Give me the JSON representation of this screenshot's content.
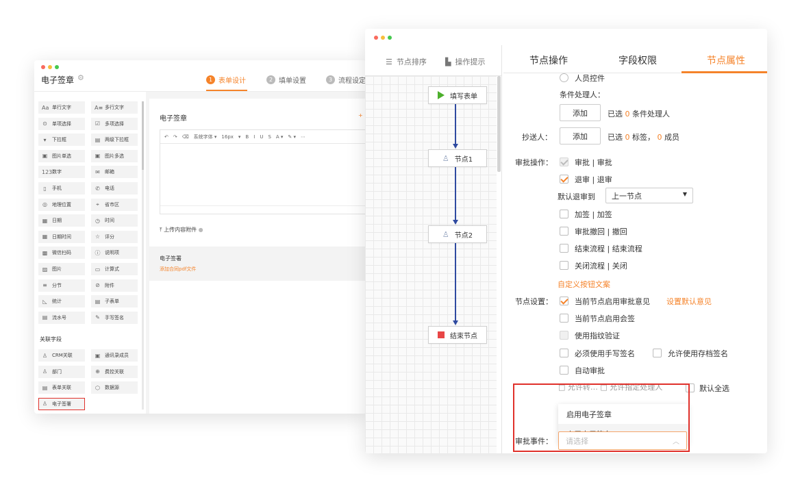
{
  "back_window": {
    "app_title": "电子签章",
    "steps": [
      {
        "num": "1",
        "label": "表单设计"
      },
      {
        "num": "2",
        "label": "填单设置"
      },
      {
        "num": "3",
        "label": "流程设定"
      }
    ],
    "basic_fields": [
      {
        "label": "单行文字",
        "icon": "Aa"
      },
      {
        "label": "多行文字",
        "icon": "A≡"
      },
      {
        "label": "单项选择",
        "icon": "⊙"
      },
      {
        "label": "多项选择",
        "icon": "☑"
      },
      {
        "label": "下拉框",
        "icon": "▾"
      },
      {
        "label": "两级下拉框",
        "icon": "▤"
      },
      {
        "label": "图片单选",
        "icon": "▣"
      },
      {
        "label": "图片多选",
        "icon": "▣"
      },
      {
        "label": "数字",
        "icon": "123"
      },
      {
        "label": "邮箱",
        "icon": "✉"
      },
      {
        "label": "手机",
        "icon": "▯"
      },
      {
        "label": "电话",
        "icon": "✆"
      },
      {
        "label": "地理位置",
        "icon": "◎"
      },
      {
        "label": "省市区",
        "icon": "⌖"
      },
      {
        "label": "日期",
        "icon": "▦"
      },
      {
        "label": "时间",
        "icon": "◷"
      },
      {
        "label": "日期时间",
        "icon": "▦"
      },
      {
        "label": "评分",
        "icon": "☆"
      },
      {
        "label": "微信扫码",
        "icon": "▩"
      },
      {
        "label": "说明项",
        "icon": "ⓘ"
      },
      {
        "label": "图片",
        "icon": "▨"
      },
      {
        "label": "计算式",
        "icon": "▭"
      },
      {
        "label": "分节",
        "icon": "≡"
      },
      {
        "label": "附件",
        "icon": "⊘"
      },
      {
        "label": "统计",
        "icon": "◺"
      },
      {
        "label": "子表单",
        "icon": "▤"
      },
      {
        "label": "流水号",
        "icon": "▤"
      },
      {
        "label": "手写签名",
        "icon": "✎"
      }
    ],
    "related_section_title": "关联字段",
    "related_fields": [
      {
        "label": "CRM关联",
        "icon": "♙"
      },
      {
        "label": "通讯录成员",
        "icon": "▣"
      },
      {
        "label": "部门",
        "icon": "♙"
      },
      {
        "label": "费控关联",
        "icon": "⊕"
      },
      {
        "label": "表单关联",
        "icon": "▤"
      },
      {
        "label": "数据源",
        "icon": "⬡"
      },
      {
        "label": "电子签署",
        "icon": "♙"
      }
    ],
    "form_title": "电子签章",
    "toolbar": [
      "↶",
      "↷",
      "⌫",
      "系统字体 ▾",
      "16px",
      "▾",
      "B",
      "I",
      "U",
      "S",
      "A ▾",
      "✎ ▾",
      "⋯"
    ],
    "upload_label": "上传内容附件",
    "signature_block": {
      "title": "电子签署",
      "subtitle": "添加合同pdf文件"
    }
  },
  "front_window": {
    "left_tabs": [
      {
        "icon": "☰",
        "label": "节点排序"
      },
      {
        "icon": "▙",
        "label": "操作提示"
      }
    ],
    "nodes": [
      {
        "label": "填写表单",
        "kind": "start"
      },
      {
        "label": "节点1",
        "kind": "node"
      },
      {
        "label": "节点2",
        "kind": "node"
      },
      {
        "label": "结束节点",
        "kind": "end"
      }
    ],
    "right_tabs": [
      "节点操作",
      "字段权限",
      "节点属性"
    ],
    "props": {
      "person_control": "人员控件",
      "condition_handler_label": "条件处理人：",
      "add_button": "添加",
      "selected_prefix": "已选",
      "condition_count": "0",
      "condition_suffix": "条件处理人",
      "cc_label": "抄送人：",
      "cc_tag_count": "0",
      "cc_tag_suffix": "标签，",
      "cc_member_count": "0",
      "cc_member_suffix": "成员",
      "approve_ops_label": "审批操作：",
      "ops": [
        {
          "label": "审批 | 审批",
          "checked": true,
          "disabled": true
        },
        {
          "label": "退审 | 退审",
          "checked": true,
          "disabled": false
        }
      ],
      "default_return_label": "默认退审到",
      "default_return_value": "上一节点",
      "more_ops": [
        "加签 | 加签",
        "审批撤回 | 撤回",
        "结束流程 | 结束流程",
        "关闭流程 | 关闭"
      ],
      "custom_button_text": "自定义按钮文案",
      "node_settings_label": "节点设置：",
      "settings": [
        {
          "label": "当前节点启用审批意见",
          "checked": true,
          "disabled": false
        },
        {
          "label": "当前节点启用会签",
          "checked": false,
          "disabled": false
        },
        {
          "label": "使用指纹验证",
          "checked": false,
          "disabled": true
        },
        {
          "label": "必须使用手写签名",
          "checked": false,
          "disabled": false
        },
        {
          "label": "自动审批",
          "checked": false,
          "disabled": false
        }
      ],
      "set_default_opinion": "设置默认意见",
      "allow_archived_signature": "允许使用存档签名",
      "obscured_text": "□ 允许转…  □ 允许指定处理人",
      "default_select_all": "默认全选",
      "dropdown_options": [
        "启用电子签章",
        "启用电子签名"
      ],
      "approval_event_label": "审批事件：",
      "approval_event_placeholder": "请选择"
    }
  }
}
